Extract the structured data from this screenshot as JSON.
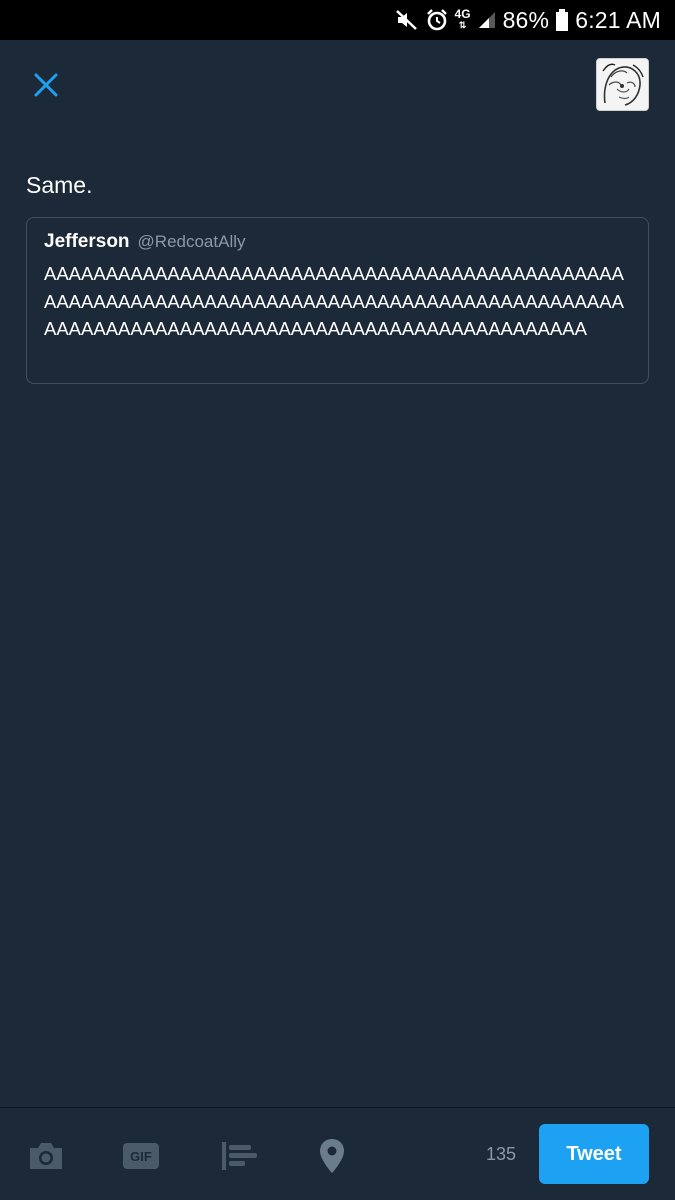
{
  "status_bar": {
    "network": "4G",
    "battery_percent": "86%",
    "time": "6:21 AM",
    "icons": [
      "mute-icon",
      "alarm-icon",
      "network-4g-icon",
      "signal-icon",
      "battery-icon"
    ]
  },
  "header": {
    "close_icon": "close-icon",
    "avatar": "user-avatar"
  },
  "compose": {
    "text": "Same."
  },
  "quoted_tweet": {
    "name": "Jefferson",
    "handle": "@RedcoatAlly",
    "text": "AAAAAAAAAAAAAAAAAAAAAAAAAAAAAAAAAAAAAAAAAAAAAAAAAAAAAAAAAAAAAAAAAAAAAAAAAAAAAAAAAAAAAAAAAAAAAAAAAAAAAAAAAAAAAAAAAAAAAAAAAAAAAAAAAAAAAAAAAA"
  },
  "toolbar": {
    "icons": [
      "camera-icon",
      "gif-icon",
      "poll-icon",
      "location-pin-icon"
    ],
    "gif_label": "GIF",
    "char_count": "135",
    "tweet_label": "Tweet"
  },
  "colors": {
    "background": "#1c2938",
    "accent": "#1da1f2",
    "muted": "#8899a6",
    "border": "#3d4f62"
  }
}
